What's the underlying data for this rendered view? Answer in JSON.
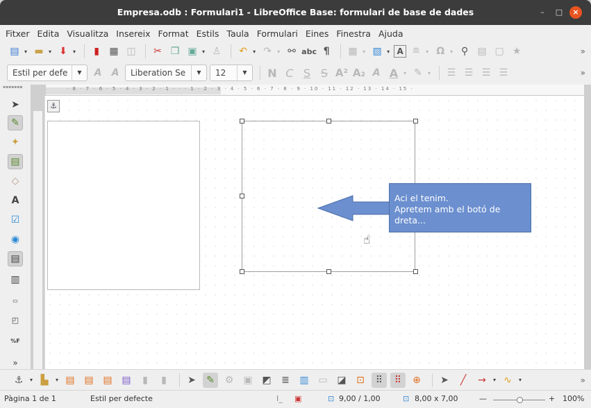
{
  "window": {
    "title": "Empresa.odb : Formulari1 - LibreOffice Base: formulari de base de dades",
    "controls": [
      "–",
      "□",
      "×"
    ]
  },
  "menu": [
    "Fitxer",
    "Edita",
    "Visualitza",
    "Insereix",
    "Format",
    "Estils",
    "Taula",
    "Formulari",
    "Eines",
    "Finestra",
    "Ajuda"
  ],
  "formatting": {
    "paragraph_style": "Estil per defe",
    "font_name": "Liberation Se",
    "font_size": "12",
    "bold": "N",
    "italic": "C",
    "underline": "S",
    "strike": "S",
    "superscript": "A²",
    "subscript": "A₂",
    "font_color": "A"
  },
  "ruler": {
    "labels": "· 8 · 7 · 6 · 5 · 4 · 3 · 2 · 1 · · · 1 · 2 · 3 · 4 · 5 · 6 · 7 · 8 · 9 · 10 · 11 · 12 · 13 · 14 · 15 ·"
  },
  "callout": {
    "line1": "Aci el tenim.",
    "line2": "Apretem amb el botó de dreta..."
  },
  "status": {
    "page": "Pàgina 1 de 1",
    "page_style": "Estil per defecte",
    "position": "9,00 / 1,00",
    "size": "8,00 x 7,00",
    "zoom": "100%",
    "zoom_minus": "—",
    "zoom_plus": "+"
  },
  "colors": {
    "callout_fill": "#6b8fcf",
    "title_bg": "#3c3c3c",
    "close_button": "#e95420"
  }
}
